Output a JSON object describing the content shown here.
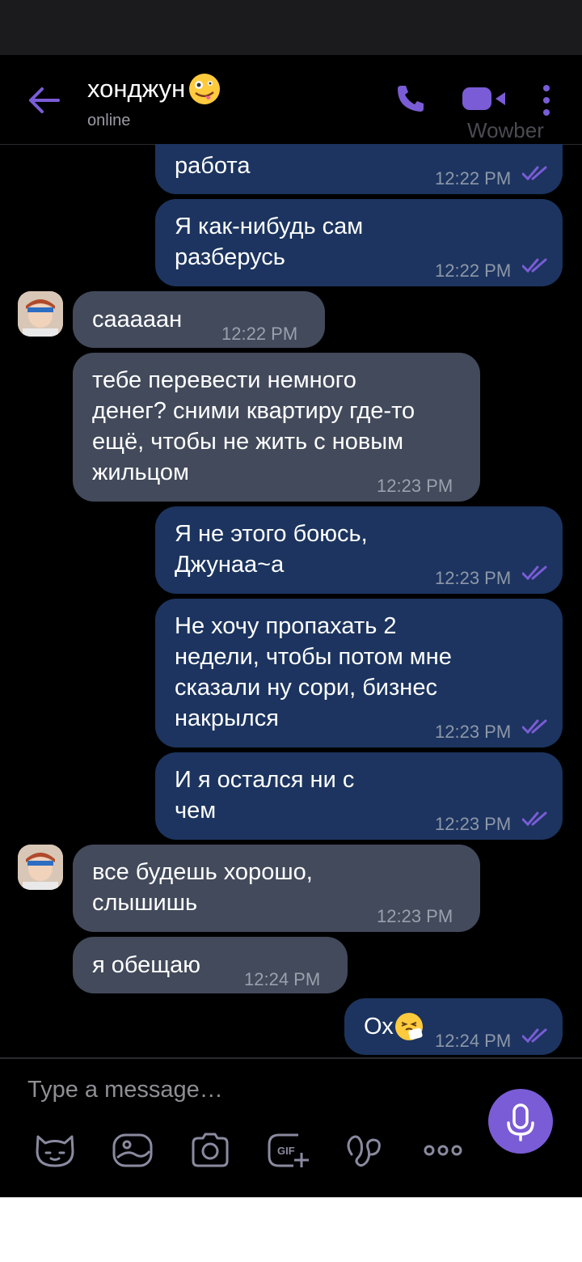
{
  "header": {
    "title": "хонджун",
    "status": "online",
    "watermark": "Wowber",
    "accent": "#7a5cd6"
  },
  "messages": [
    {
      "dir": "out",
      "text": "работа",
      "time": "12:22 PM",
      "read": true
    },
    {
      "dir": "out",
      "text": "Я как-нибудь сам\nразберусь",
      "time": "12:22 PM",
      "read": true
    },
    {
      "dir": "in",
      "text": "сааааан",
      "time": "12:22 PM",
      "avatar": true
    },
    {
      "dir": "in",
      "text": "тебе перевести немного\nденег? сними квартиру где-то\nещё, чтобы не жить с новым\nжильцом",
      "time": "12:23 PM"
    },
    {
      "dir": "out",
      "text": "Я не этого боюсь,\nДжунаа~а",
      "time": "12:23 PM",
      "read": true
    },
    {
      "dir": "out",
      "text": "Не хочу пропахать 2\nнедели, чтобы потом мне\nсказали ну сори, бизнес\nнакрылся",
      "time": "12:23 PM",
      "read": true
    },
    {
      "dir": "out",
      "text": "И я остался ни с\nчем",
      "time": "12:23 PM",
      "read": true
    },
    {
      "dir": "in",
      "text": "все будешь хорошо,\nслышишь",
      "time": "12:23 PM",
      "avatar": true
    },
    {
      "dir": "in",
      "text": "я обещаю",
      "time": "12:24 PM"
    },
    {
      "dir": "out",
      "text": "Ох",
      "time": "12:24 PM",
      "read": true,
      "emoji": "sneezing-face"
    }
  ],
  "composer": {
    "placeholder": "Type a message…",
    "tools": [
      "sticker-icon",
      "gallery-icon",
      "camera-icon",
      "gif-icon",
      "doodle-icon",
      "more-options-icon"
    ]
  }
}
